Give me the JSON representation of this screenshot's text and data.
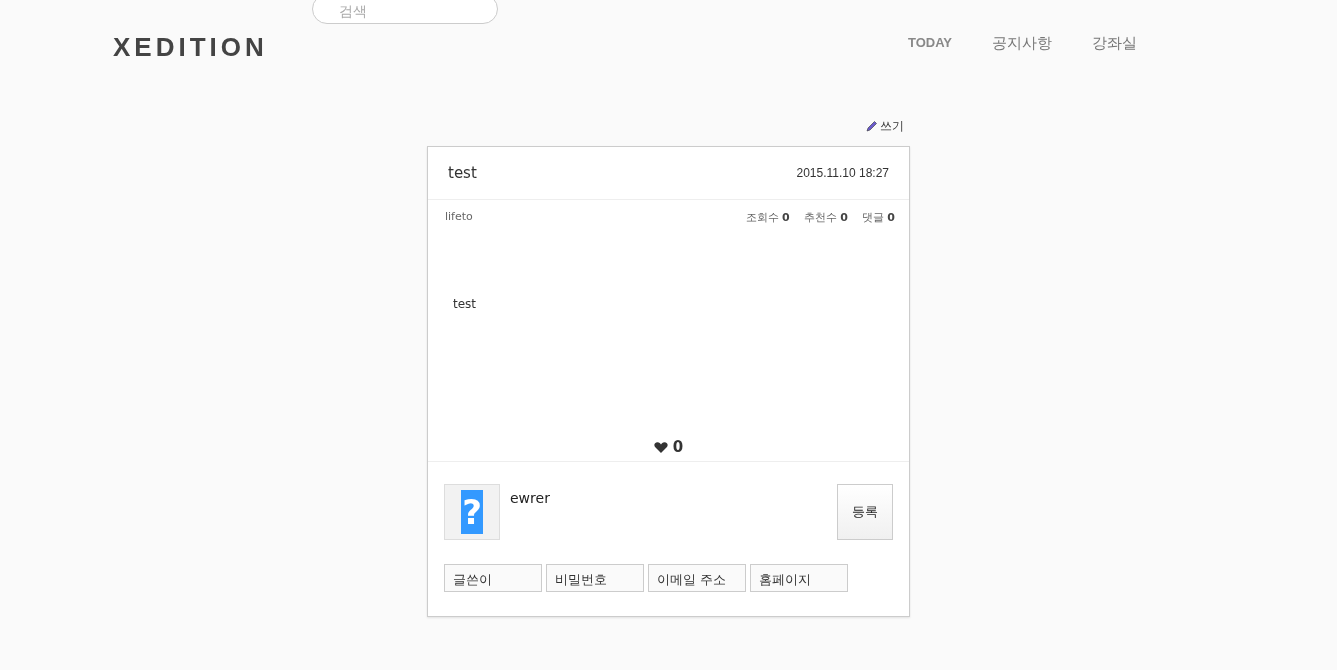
{
  "header": {
    "logo": "XEDITION",
    "search": {
      "placeholder": "검색"
    },
    "nav": [
      {
        "label": "TODAY",
        "selected": true
      },
      {
        "label": "공지사항",
        "selected": false
      },
      {
        "label": "강좌실",
        "selected": false
      }
    ]
  },
  "write_link": "쓰기",
  "post": {
    "title": "test",
    "date": "2015.11.10 18:27",
    "author": "lifeto",
    "stats": [
      {
        "label": "조회수",
        "value": "0"
      },
      {
        "label": "추천수",
        "value": "0"
      },
      {
        "label": "댓글",
        "value": "0"
      }
    ],
    "body": "test",
    "likes": "0"
  },
  "comment_form": {
    "avatar": {
      "glyph": "?",
      "highlighted": true
    },
    "value": "ewrer",
    "submit": "등록",
    "fields": [
      {
        "placeholder": "글쓴이"
      },
      {
        "placeholder": "비밀번호"
      },
      {
        "placeholder": "이메일 주소"
      },
      {
        "placeholder": "홈페이지"
      }
    ]
  }
}
